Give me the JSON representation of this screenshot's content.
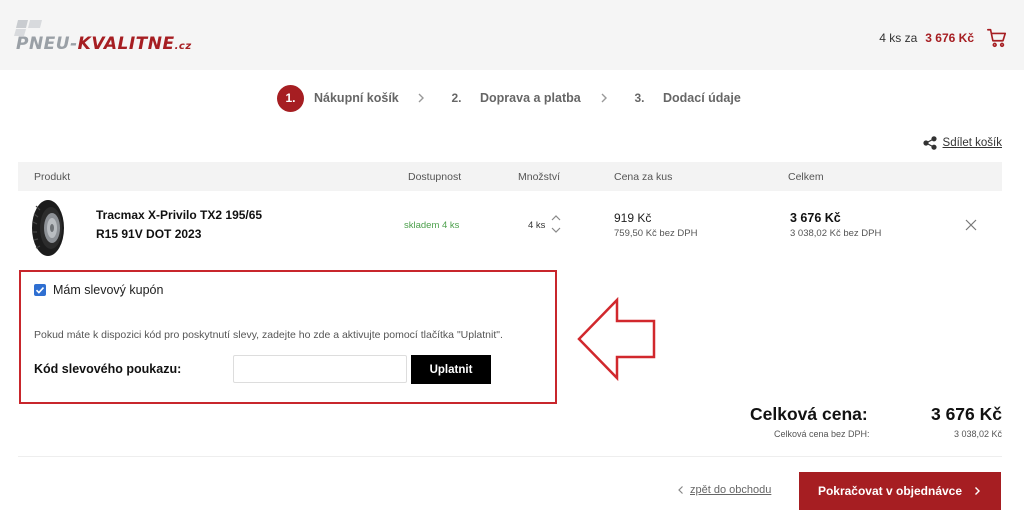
{
  "header": {
    "logo_text_main": "PNEU-",
    "logo_text_brand": "KVALITNE",
    "logo_tld": ".cz",
    "cart_count": "4 ks za",
    "cart_total": "3 676 Kč",
    "accent_color": "#a61e22"
  },
  "steps": [
    {
      "number": "1.",
      "label": "Nákupní košík",
      "active": true
    },
    {
      "number": "2.",
      "label": "Doprava a platba",
      "active": false
    },
    {
      "number": "3.",
      "label": "Dodací údaje",
      "active": false
    }
  ],
  "share": {
    "label": "Sdílet košík",
    "icon": "share-icon"
  },
  "table": {
    "headers": {
      "product": "Produkt",
      "availability": "Dostupnost",
      "quantity": "Množství",
      "unit_price": "Cena za kus",
      "total": "Celkem"
    },
    "rows": [
      {
        "name": "Tracmax X-Privilo TX2 195/65 R15 91V DOT 2023",
        "stock": "skladem 4 ks",
        "quantity": "4 ks",
        "price": "919 Kč",
        "price_net": "759,50 Kč bez DPH",
        "total": "3 676 Kč",
        "total_net": "3 038,02 Kč bez DPH"
      }
    ]
  },
  "coupon": {
    "checkbox_label": "Mám slevový kupón",
    "checked": true,
    "info": "Pokud máte k dispozici kód pro poskytnutí slevy, zadejte ho zde a aktivujte pomocí tlačítka \"Uplatnit\".",
    "field_label": "Kód slevového poukazu:",
    "input_value": "",
    "button_label": "Uplatnit"
  },
  "summary": {
    "grand_label": "Celková cena:",
    "grand_value": "3 676 Kč",
    "net_label": "Celková cena bez DPH:",
    "net_value": "3 038,02 Kč"
  },
  "footer": {
    "back_label": "zpět do obchodu",
    "continue_label": "Pokračovat v objednávce"
  }
}
